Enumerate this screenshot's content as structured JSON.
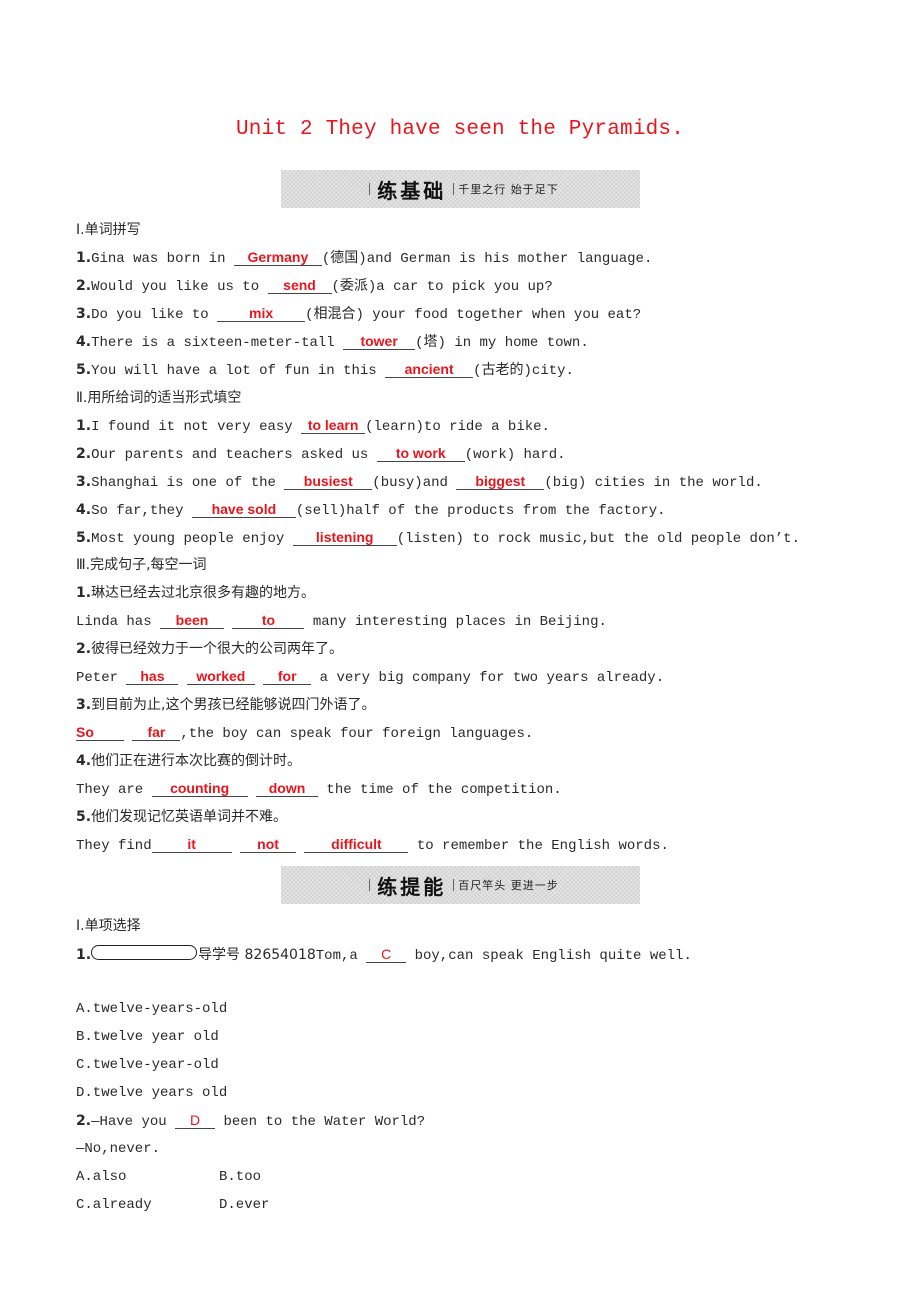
{
  "title": "Unit 2  They have seen the Pyramids.",
  "banners": [
    {
      "main": "练基础",
      "sub": "千里之行  始于足下"
    },
    {
      "main": "练提能",
      "sub": "百尺竿头  更进一步"
    }
  ],
  "part1": {
    "heading": "Ⅰ.单词拼写",
    "items": [
      {
        "num": "1.",
        "pre": "Gina was born in ",
        "answer": "Germany",
        "post": "(德国)and German is his mother language."
      },
      {
        "num": "2.",
        "pre": "Would you like us to ",
        "answer": "send",
        "post": "(委派)a car to pick you up?"
      },
      {
        "num": "3.",
        "pre": "Do you like to ",
        "answer": "mix",
        "post": "(相混合) your food together when you eat?"
      },
      {
        "num": "4.",
        "pre": "There is a sixteen-meter-tall ",
        "answer": "tower",
        "post": "(塔) in my home town."
      },
      {
        "num": "5.",
        "pre": "You will have a lot of fun in this ",
        "answer": "ancient",
        "post": "(古老的)city."
      }
    ]
  },
  "part2": {
    "heading": "Ⅱ.用所给词的适当形式填空",
    "items": [
      {
        "num": "1.",
        "pre": "I found it not very easy ",
        "answer": "to learn",
        "post": "(learn)to ride a bike."
      },
      {
        "num": "2.",
        "pre": "Our parents and teachers asked us ",
        "answer": "to work",
        "post": "(work) hard."
      },
      {
        "num": "3.",
        "pre": "Shanghai is one of the ",
        "answer": "busiest",
        "mid": "(busy)and ",
        "answer2": "biggest",
        "post": "(big) cities in the world."
      },
      {
        "num": "4.",
        "pre": "So far,they ",
        "answer": "have sold",
        "post": "(sell)half of the products from the factory."
      },
      {
        "num": "5.",
        "pre": "Most young people enjoy ",
        "answer": "listening",
        "post": "(listen) to rock music,but the old people don’t."
      }
    ]
  },
  "part3": {
    "heading": "Ⅲ.完成句子,每空一词",
    "items": [
      {
        "num": "1.",
        "cn": "琳达已经去过北京很多有趣的地方。",
        "pre": "Linda has ",
        "answers": [
          "been",
          "to"
        ],
        "post": " many interesting places in Beijing."
      },
      {
        "num": "2.",
        "cn": "彼得已经效力于一个很大的公司两年了。",
        "pre": "Peter ",
        "answers": [
          "has",
          "worked",
          "for"
        ],
        "post": " a very big company for two years already."
      },
      {
        "num": "3.",
        "cn": "到目前为止,这个男孩已经能够说四门外语了。",
        "pre": "",
        "answers": [
          "So",
          "far"
        ],
        "post": ",the boy can speak four foreign languages."
      },
      {
        "num": "4.",
        "cn": "他们正在进行本次比赛的倒计时。",
        "pre": "They are ",
        "answers": [
          "counting",
          "down"
        ],
        "post": " the time of the competition."
      },
      {
        "num": "5.",
        "cn": "他们发现记忆英语单词并不难。",
        "pre": "They find",
        "answers": [
          "it",
          "not",
          "difficult"
        ],
        "post": " to remember the English words."
      }
    ]
  },
  "part4": {
    "heading": "Ⅰ.单项选择",
    "q1": {
      "num": "1.",
      "guide": "导学号 82654018",
      "pre": "Tom,a ",
      "answer": "C",
      "post": " boy,can speak English quite well.",
      "options": [
        "A.twelve-years-old",
        "B.twelve year old",
        "C.twelve-year-old",
        "D.twelve years old"
      ]
    },
    "q2": {
      "num": "2.",
      "pre": "—Have you ",
      "answer": "D",
      "post": " been to the Water World?",
      "reply": "—No,never.",
      "options": [
        "A.also",
        "B.too",
        "C.already",
        "D.ever"
      ]
    }
  },
  "colors": {
    "answer": "#e8161c",
    "title": "#e8161c",
    "banner": "#dcdcdc"
  }
}
